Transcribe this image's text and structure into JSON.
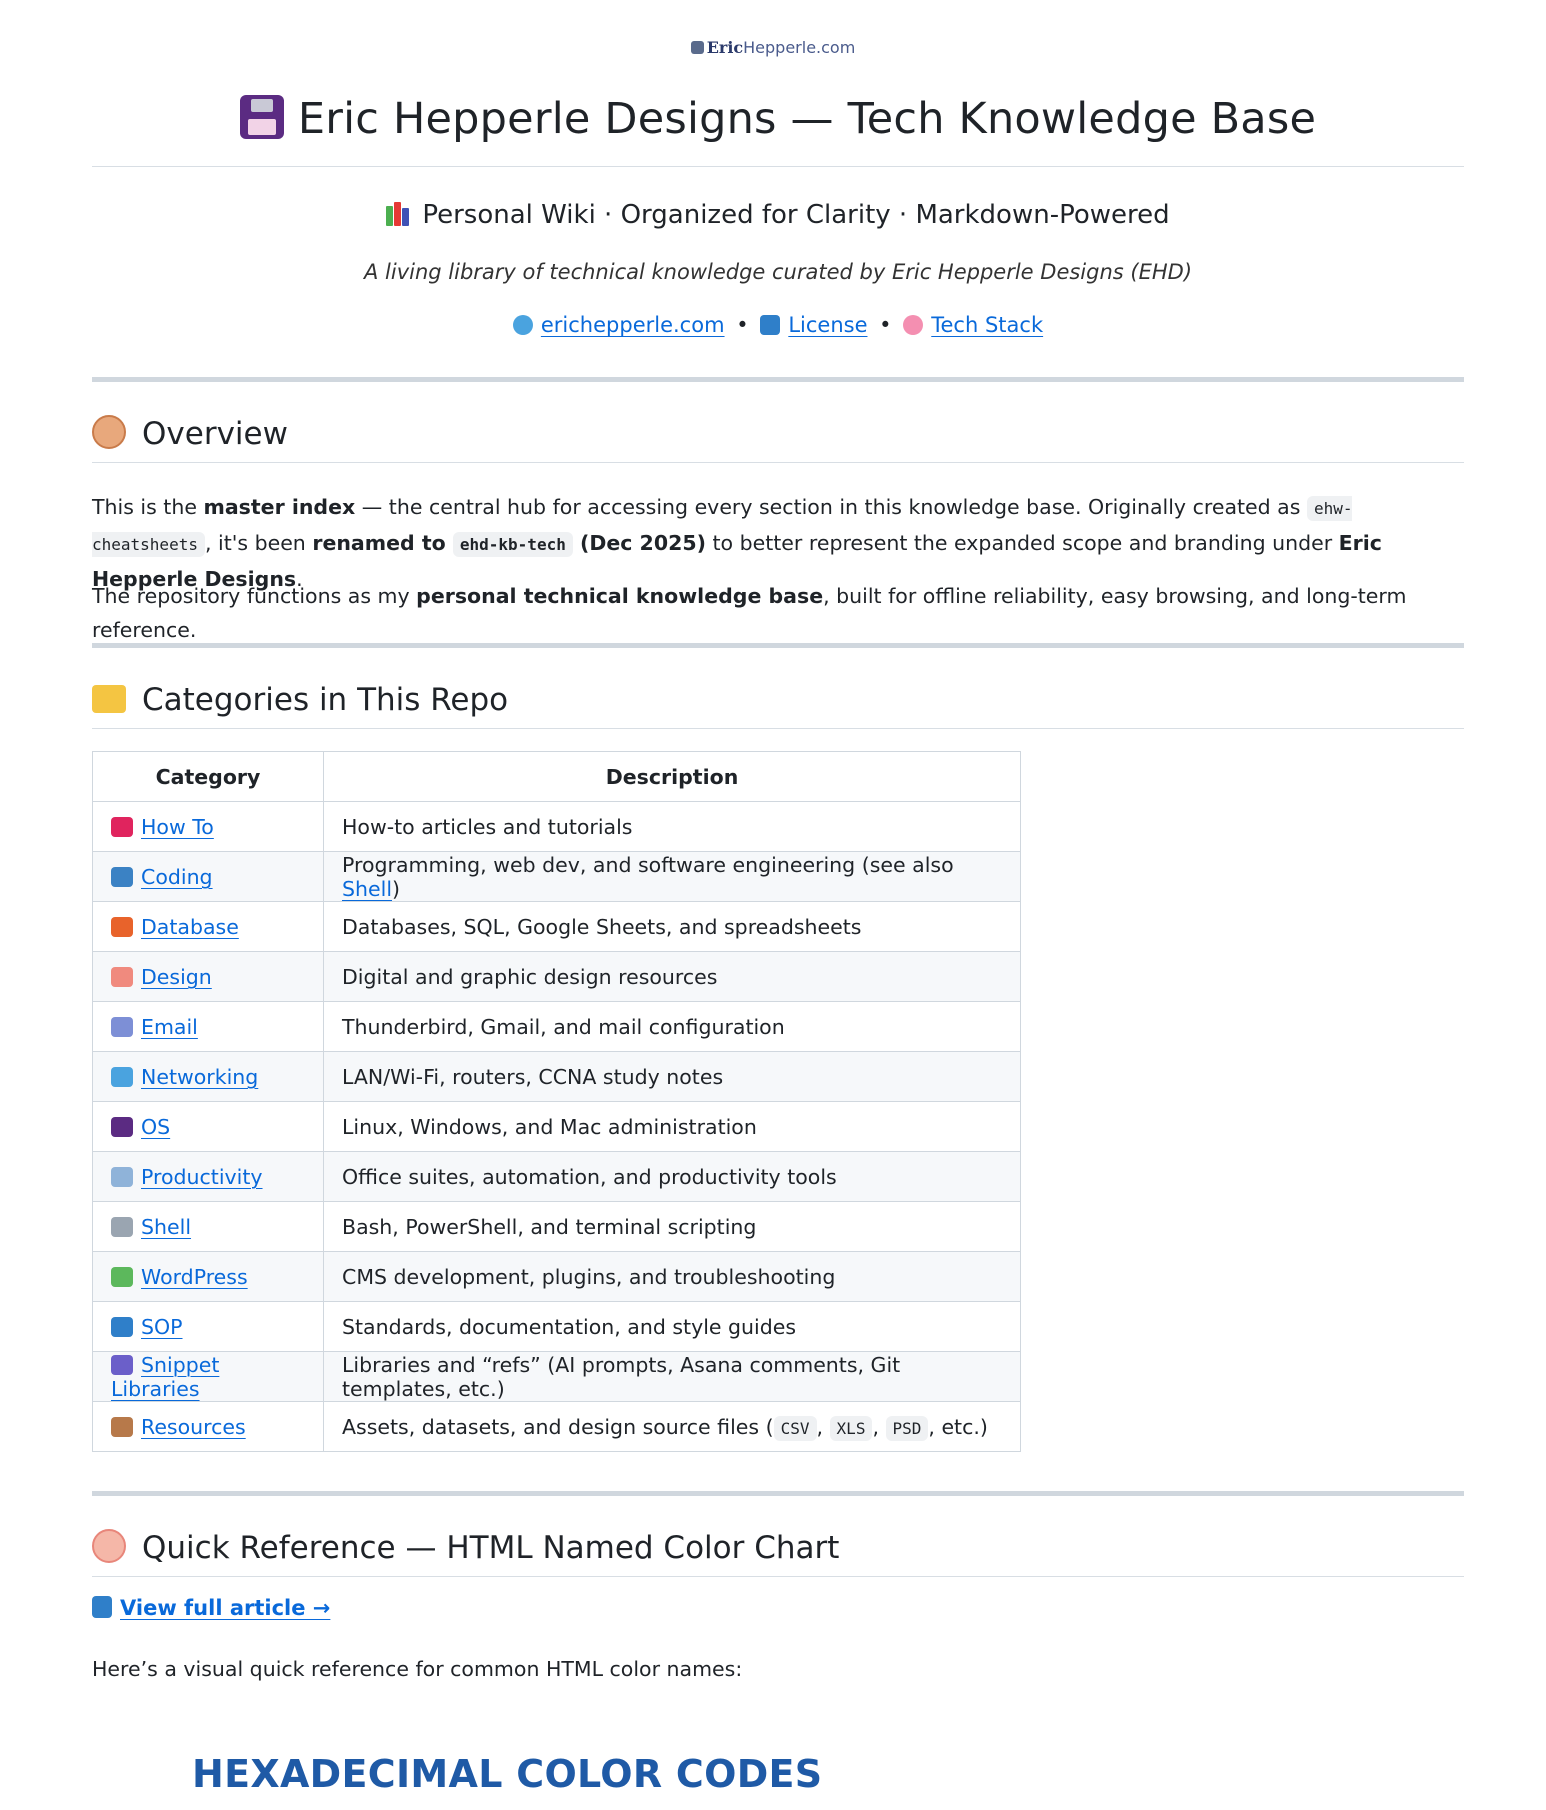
{
  "logo": {
    "bold": "Eric",
    "thin": "Hepperle.com"
  },
  "title": "Eric Hepperle Designs — Tech Knowledge Base",
  "subtitle": "Personal Wiki · Organized for Clarity · Markdown-Powered",
  "tagline": "A living library of technical knowledge curated by Eric Hepperle Designs (EHD)",
  "links": [
    {
      "label": "erichepperle.com",
      "icon": "globe-icon"
    },
    {
      "label": "License",
      "icon": "book-icon"
    },
    {
      "label": "Tech Stack",
      "icon": "brain-icon"
    }
  ],
  "link_separator": "•",
  "overview": {
    "heading": "Overview",
    "p1_a": "This is the ",
    "p1_b": "master index",
    "p1_c": " — the central hub for accessing every section in this knowledge base. Originally created as ",
    "p1_code1": "ehw-cheatsheets",
    "p1_d": ", it's been ",
    "p1_e": "renamed to ",
    "p1_code2": "ehd-kb-tech",
    "p1_f": " (Dec 2025)",
    "p1_g": " to better represent the expanded scope and branding under ",
    "p1_h": "Eric Hepperle Designs",
    "p1_i": ".",
    "p2_a": "The repository functions as my ",
    "p2_b": "personal technical knowledge base",
    "p2_c": ", built for offline reliability, easy browsing, and long-term reference."
  },
  "categories": {
    "heading": "Categories in This Repo",
    "col_category": "Category",
    "col_description": "Description",
    "rows": [
      {
        "name": "How To",
        "desc": "How-to articles and tutorials",
        "icon": "toolbox-icon",
        "color": "#e0245e"
      },
      {
        "name": "Coding",
        "desc": "Programming, web dev, and software engineering (see also ",
        "desc_link": "Shell",
        "desc_end": ")",
        "icon": "laptop-icon",
        "color": "#3b82c4"
      },
      {
        "name": "Database",
        "desc": "Databases, SQL, Google Sheets, and spreadsheets",
        "icon": "spreadsheet-icon",
        "color": "#e8632b"
      },
      {
        "name": "Design",
        "desc": "Digital and graphic design resources",
        "icon": "palette-icon",
        "color": "#f08a7e"
      },
      {
        "name": "Email",
        "desc": "Thunderbird, Gmail, and mail configuration",
        "icon": "email-icon",
        "color": "#7d8fd6"
      },
      {
        "name": "Networking",
        "desc": "LAN/Wi-Fi, routers, CCNA study notes",
        "icon": "globe-icon",
        "color": "#4aa3df"
      },
      {
        "name": "OS",
        "desc": "Linux, Windows, and Mac administration",
        "icon": "floppy-icon",
        "color": "#5b2b82"
      },
      {
        "name": "Productivity",
        "desc": "Office suites, automation, and productivity tools",
        "icon": "chart-icon",
        "color": "#8fb3d9"
      },
      {
        "name": "Shell",
        "desc": "Bash, PowerShell, and terminal scripting",
        "icon": "gear-icon",
        "color": "#9aa5b1"
      },
      {
        "name": "WordPress",
        "desc": "CMS development, plugins, and troubleshooting",
        "icon": "puzzle-icon",
        "color": "#5cb85c"
      },
      {
        "name": "SOP",
        "desc": "Standards, documentation, and style guides",
        "icon": "book-icon",
        "color": "#2f7fc9"
      },
      {
        "name": "Snippet Libraries",
        "desc": "Libraries and “refs” (AI prompts, Asana comments, Git templates, etc.)",
        "icon": "books-icon",
        "color": "#6b5fc9"
      },
      {
        "name": "Resources",
        "desc": "Assets, datasets, and design source files (",
        "codes": [
          "CSV",
          "XLS",
          "PSD"
        ],
        "desc_end": ", etc.)",
        "icon": "package-icon",
        "color": "#b7794a"
      }
    ]
  },
  "quickref": {
    "heading": "Quick Reference — HTML Named Color Chart",
    "view_link": "View full article →",
    "intro": "Here’s a visual quick reference for common HTML color names:",
    "image_title": "HEXADECIMAL COLOR CODES"
  }
}
